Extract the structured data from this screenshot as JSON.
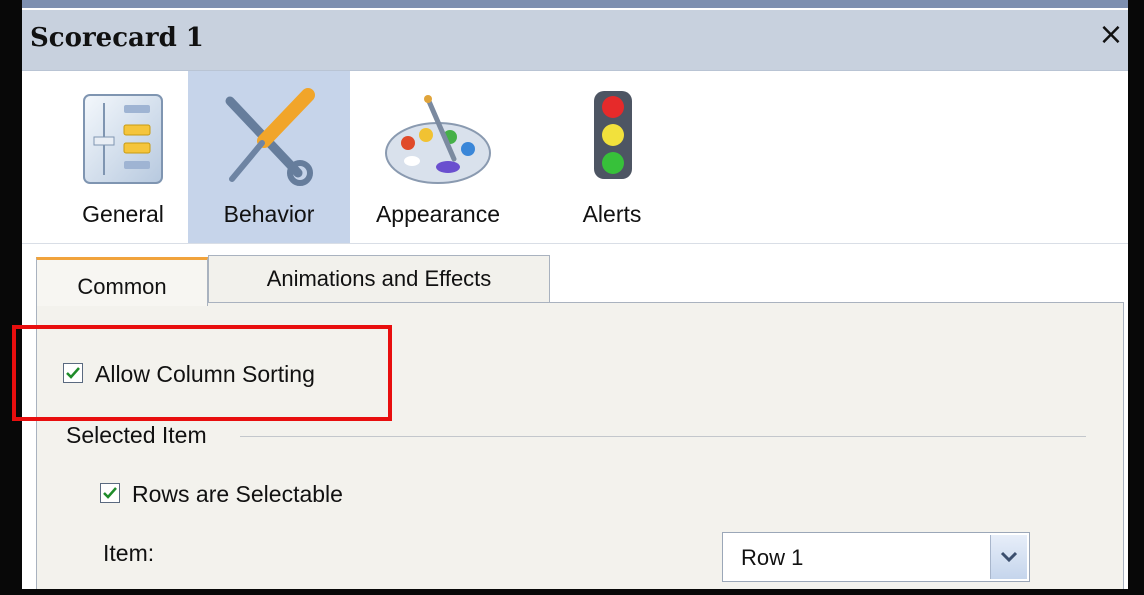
{
  "window": {
    "title": "Scorecard 1",
    "close_label": "×"
  },
  "toolbar": {
    "items": [
      {
        "label": "General",
        "icon": "general-settings-icon",
        "selected": false
      },
      {
        "label": "Behavior",
        "icon": "tools-icon",
        "selected": true
      },
      {
        "label": "Appearance",
        "icon": "palette-icon",
        "selected": false
      },
      {
        "label": "Alerts",
        "icon": "traffic-light-icon",
        "selected": false
      }
    ]
  },
  "tabs": [
    {
      "label": "Common",
      "active": true
    },
    {
      "label": "Animations and Effects",
      "active": false
    }
  ],
  "options": {
    "allow_column_sorting": {
      "label": "Allow Column Sorting",
      "checked": true
    },
    "selected_item_group": "Selected Item",
    "rows_selectable": {
      "label": "Rows are Selectable",
      "checked": true
    },
    "item_label": "Item:",
    "item_value": "Row 1"
  },
  "colors": {
    "highlight": "#e80e0e",
    "selected_tab_accent": "#f1a33c",
    "toolbar_selected": "#c6d4ea",
    "checkmark": "#1f8c2a"
  }
}
